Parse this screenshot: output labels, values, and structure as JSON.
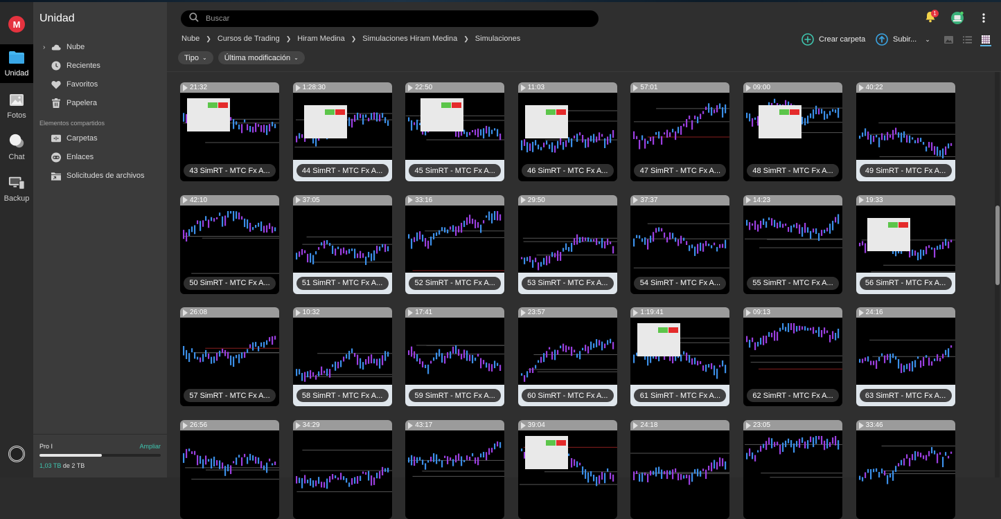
{
  "app": {
    "logo_letter": "M",
    "section_title": "Unidad"
  },
  "rail": {
    "items": [
      {
        "label": "Unidad",
        "icon": "folder-icon",
        "active": true
      },
      {
        "label": "Fotos",
        "icon": "photos-icon",
        "active": false
      },
      {
        "label": "Chat",
        "icon": "chat-icon",
        "active": false
      },
      {
        "label": "Backup",
        "icon": "backup-icon",
        "active": false
      }
    ],
    "bottom_icon": "transfers-icon"
  },
  "sidebar": {
    "items": [
      {
        "label": "Nube",
        "icon": "cloud-icon",
        "expandable": true
      },
      {
        "label": "Recientes",
        "icon": "clock-icon"
      },
      {
        "label": "Favoritos",
        "icon": "heart-icon"
      },
      {
        "label": "Papelera",
        "icon": "trash-icon"
      }
    ],
    "shared_section_label": "Elementos compartidos",
    "shared_items": [
      {
        "label": "Carpetas",
        "icon": "shared-folder-icon"
      },
      {
        "label": "Enlaces",
        "icon": "link-icon"
      },
      {
        "label": "Solicitudes de archivos",
        "icon": "file-request-icon"
      }
    ],
    "plan": {
      "name": "Pro I",
      "upgrade_label": "Ampliar",
      "used": "1,03 TB",
      "of_label": "de 2 TB",
      "used_fraction": 0.515
    }
  },
  "header": {
    "search_placeholder": "Buscar",
    "notifications_count": "1",
    "breadcrumb": [
      "Nube",
      "Cursos de Trading",
      "Hiram Medina",
      "Simulaciones Hiram Medina",
      "Simulaciones"
    ],
    "filters": [
      {
        "label": "Tipo"
      },
      {
        "label": "Última modificación"
      }
    ],
    "create_folder_label": "Crear carpeta",
    "upload_label": "Subir...",
    "view_modes": [
      "media-view",
      "list-view",
      "grid-view"
    ],
    "active_view": "grid-view"
  },
  "colors": {
    "accent_teal": "#3fc6b0",
    "upload_blue": "#3ba3e0",
    "brand_red": "#e5333f",
    "candle_purple": "#9b3fe0",
    "candle_blue": "#3b8fe8"
  },
  "files": [
    {
      "name": "43 SimRT - MTC Fx A...",
      "duration": "21:32"
    },
    {
      "name": "44 SimRT - MTC Fx A...",
      "duration": "1:28:30"
    },
    {
      "name": "45 SimRT - MTC Fx A...",
      "duration": "22:50"
    },
    {
      "name": "46 SimRT - MTC Fx A...",
      "duration": "11:03"
    },
    {
      "name": "47 SimRT - MTC Fx A...",
      "duration": "57:01"
    },
    {
      "name": "48 SimRT - MTC Fx A...",
      "duration": "09:00"
    },
    {
      "name": "49 SimRT - MTC Fx A...",
      "duration": "40:22"
    },
    {
      "name": "50 SimRT - MTC Fx A...",
      "duration": "42:10"
    },
    {
      "name": "51 SimRT - MTC Fx A...",
      "duration": "37:05"
    },
    {
      "name": "52 SimRT - MTC Fx A...",
      "duration": "33:16"
    },
    {
      "name": "53 SimRT - MTC Fx A...",
      "duration": "29:50"
    },
    {
      "name": "54 SimRT - MTC Fx A...",
      "duration": "37:37"
    },
    {
      "name": "55 SimRT - MTC Fx A...",
      "duration": "14:23"
    },
    {
      "name": "56 SimRT - MTC Fx A...",
      "duration": "19:33"
    },
    {
      "name": "57 SimRT - MTC Fx A...",
      "duration": "26:08"
    },
    {
      "name": "58 SimRT - MTC Fx A...",
      "duration": "10:32"
    },
    {
      "name": "59 SimRT - MTC Fx A...",
      "duration": "17:41"
    },
    {
      "name": "60 SimRT - MTC Fx A...",
      "duration": "23:57"
    },
    {
      "name": "61 SimRT - MTC Fx A...",
      "duration": "1:19:41"
    },
    {
      "name": "62 SimRT - MTC Fx A...",
      "duration": "09:13"
    },
    {
      "name": "63 SimRT - MTC Fx A...",
      "duration": "24:16"
    },
    {
      "name": "",
      "duration": "26:56"
    },
    {
      "name": "",
      "duration": "34:29"
    },
    {
      "name": "",
      "duration": "43:17"
    },
    {
      "name": "",
      "duration": "39:04"
    },
    {
      "name": "",
      "duration": "24:18"
    },
    {
      "name": "",
      "duration": "23:05"
    },
    {
      "name": "",
      "duration": "33:46"
    }
  ]
}
